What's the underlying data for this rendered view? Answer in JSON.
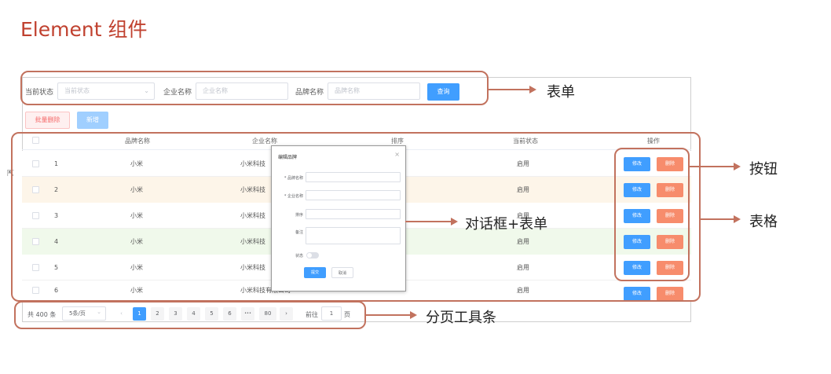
{
  "page_title": "Element 组件",
  "search_form": {
    "status_label": "当前状态",
    "status_placeholder": "当前状态",
    "company_label": "企业名称",
    "company_placeholder": "企业名称",
    "brand_label": "品牌名称",
    "brand_placeholder": "品牌名称",
    "query_label": "查询"
  },
  "toolbar": {
    "batch_delete_label": "批量删除",
    "add_label": "新增"
  },
  "table": {
    "headers": {
      "brand": "品牌名称",
      "company": "企业名称",
      "order": "排序",
      "status": "当前状态",
      "ops": "操作"
    },
    "rows": [
      {
        "index": "1",
        "brand": "小米",
        "company": "小米科技",
        "status": "启用"
      },
      {
        "index": "2",
        "brand": "小米",
        "company": "小米科技",
        "status": "启用"
      },
      {
        "index": "3",
        "brand": "小米",
        "company": "小米科技",
        "status": "启用"
      },
      {
        "index": "4",
        "brand": "小米",
        "company": "小米科技",
        "status": "启用"
      },
      {
        "index": "5",
        "brand": "小米",
        "company": "小米科技",
        "status": "启用"
      },
      {
        "index": "6",
        "brand": "小米",
        "company": "小米科技有限公司",
        "status": "启用"
      }
    ],
    "edit_label": "修改",
    "delete_label": "删除"
  },
  "dialog": {
    "title": "编辑品牌",
    "close_glyph": "×",
    "brand_label": "* 品牌名称",
    "company_label": "* 企业名称",
    "order_label": "排序",
    "remark_label": "备注",
    "status_label": "状态",
    "submit_label": "提交",
    "cancel_label": "取消"
  },
  "pagination": {
    "total": "共 400 条",
    "page_size": "5条/页",
    "size_arrow": "⌄",
    "prev": "‹",
    "next": "›",
    "pages": [
      "1",
      "2",
      "3",
      "4",
      "5",
      "6",
      "•••",
      "80"
    ],
    "current_page": "1",
    "goto_label": "前往",
    "goto_value": "1",
    "page_suffix": "页"
  },
  "annotations": {
    "form": "表单",
    "buttons": "按钮",
    "dialog_form": "对话框+表单",
    "table": "表格",
    "pagination": "分页工具条"
  },
  "colors": {
    "primary": "#409eff",
    "danger": "#f78c6c",
    "annotation": "#c2725e",
    "title": "#c0412f"
  }
}
